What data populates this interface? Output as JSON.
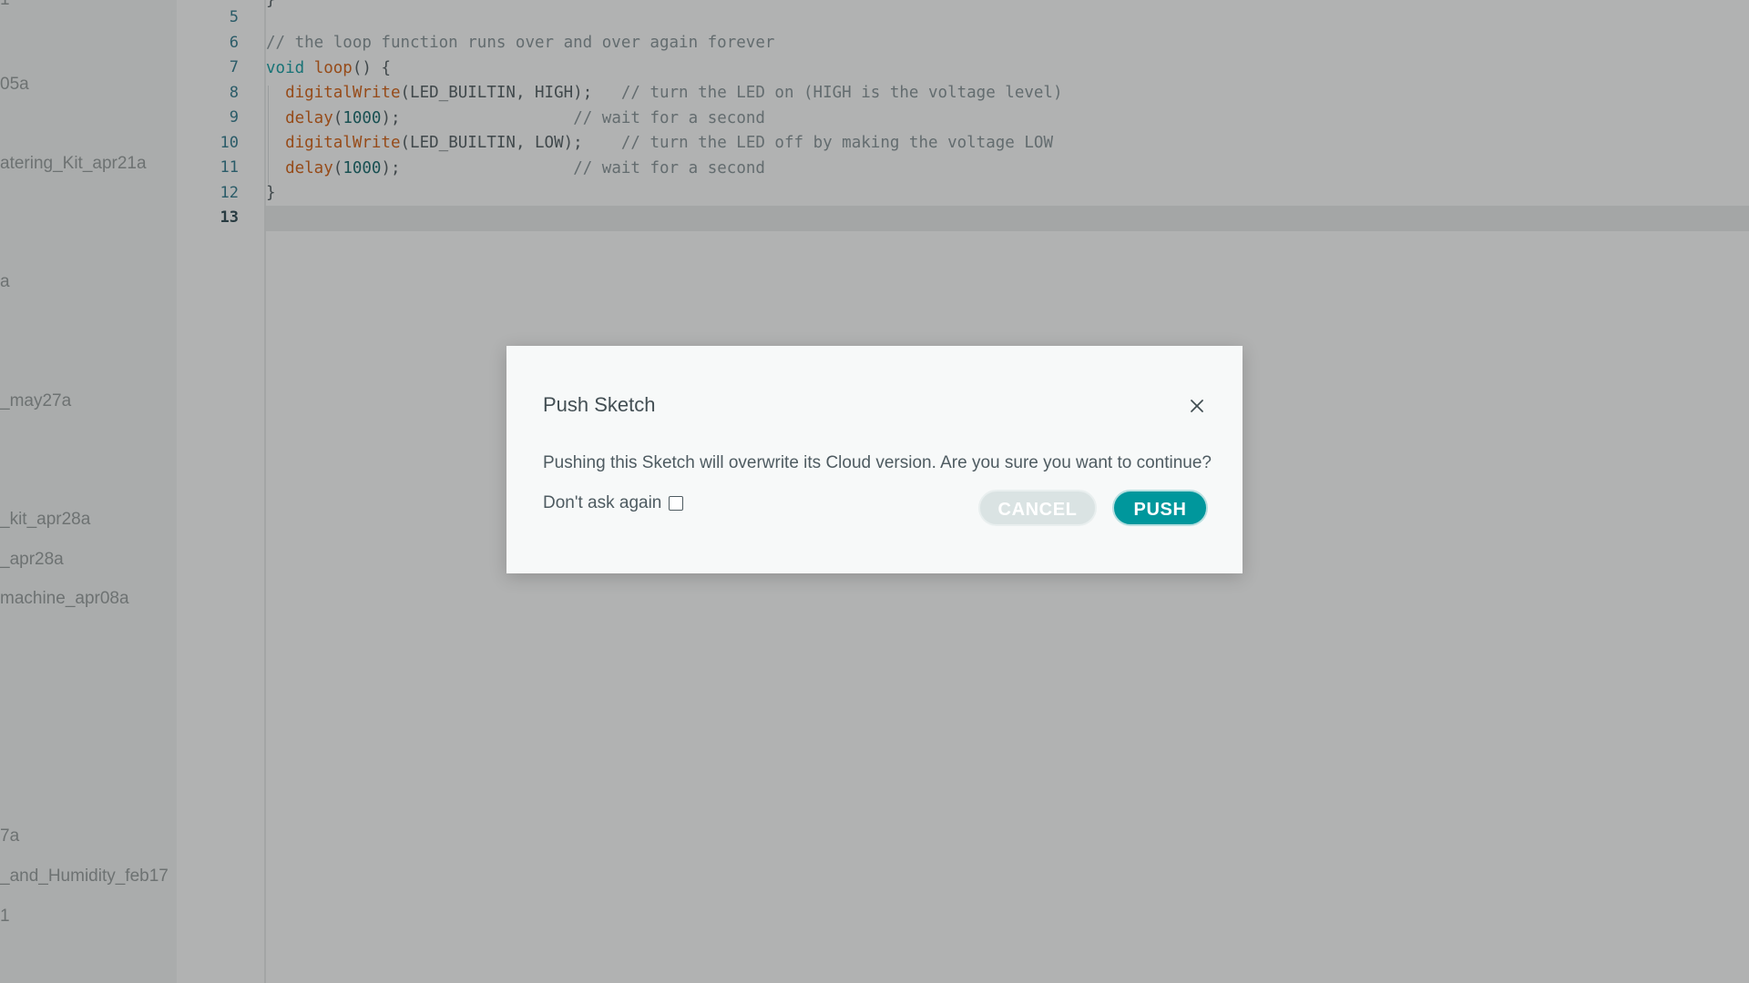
{
  "sidebar": {
    "items": [
      {
        "label": "1"
      },
      {
        "label": "05a"
      },
      {
        "label": "atering_Kit_apr21a"
      },
      {
        "label": "a"
      },
      {
        "label": "_may27a"
      },
      {
        "label": "_kit_apr28a"
      },
      {
        "label": "_apr28a"
      },
      {
        "label": "machine_apr08a"
      },
      {
        "label": "7a"
      },
      {
        "label": "_and_Humidity_feb17"
      },
      {
        "label": "1"
      }
    ]
  },
  "editor": {
    "line_numbers": [
      "5",
      "6",
      "7",
      "8",
      "9",
      "10",
      "11",
      "12",
      "13"
    ],
    "active_line": "13",
    "lines": [
      {
        "top": "}"
      },
      {
        "blank": ""
      },
      {
        "comment": "// the loop function runs over and over again forever"
      },
      {
        "kw": "void",
        "fn": "loop",
        "rest": "() {"
      },
      {
        "fn": "digitalWrite",
        "args": "(LED_BUILTIN, HIGH);",
        "pad": "   ",
        "comment": "// turn the LED on (HIGH is the voltage level)"
      },
      {
        "fn": "delay",
        "open": "(",
        "num": "1000",
        "close": ");",
        "pad": "                  ",
        "comment": "// wait for a second"
      },
      {
        "fn": "digitalWrite",
        "args": "(LED_BUILTIN, LOW);",
        "pad": "    ",
        "comment": "// turn the LED off by making the voltage LOW"
      },
      {
        "fn": "delay",
        "open": "(",
        "num": "1000",
        "close": ");",
        "pad": "                  ",
        "comment": "// wait for a second"
      },
      {
        "brace": "}"
      }
    ]
  },
  "modal": {
    "title": "Push Sketch",
    "close_icon": "close-icon",
    "message": "Pushing this Sketch will overwrite its Cloud version. Are you sure you want to continue?",
    "dont_ask_label": "Don't ask again",
    "dont_ask_checked": false,
    "cancel_label": "CANCEL",
    "push_label": "PUSH"
  },
  "colors": {
    "accent": "#00979c",
    "function": "#d35400",
    "comment": "#7d8a8f"
  }
}
